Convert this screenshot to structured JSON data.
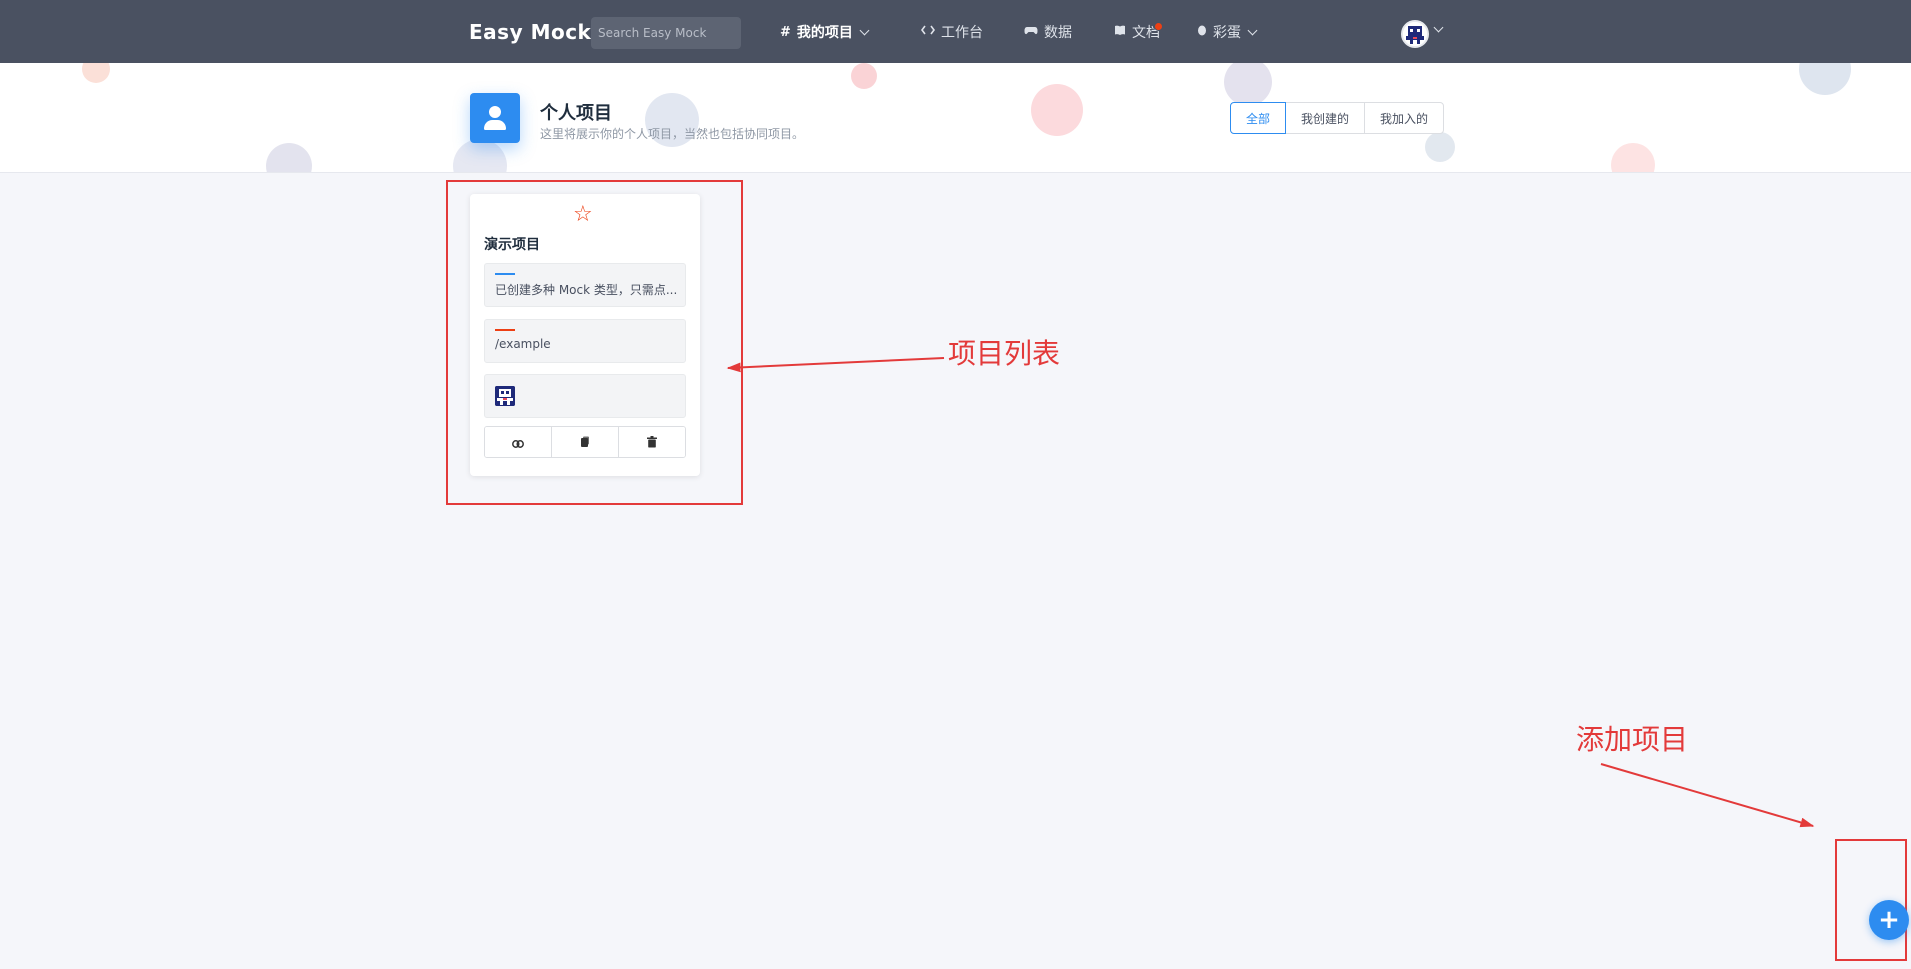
{
  "navbar": {
    "logo": "Easy Mock",
    "search_placeholder": "Search Easy Mock",
    "items": [
      {
        "label": "我的项目",
        "icon": "hash-icon",
        "has_dropdown": true,
        "active": true
      },
      {
        "label": "工作台",
        "icon": "code-icon",
        "has_dropdown": false
      },
      {
        "label": "数据",
        "icon": "gamepad-icon",
        "has_dropdown": false
      },
      {
        "label": "文档",
        "icon": "book-icon",
        "has_dropdown": false,
        "has_badge_dot": true
      },
      {
        "label": "彩蛋",
        "icon": "egg-icon",
        "has_dropdown": true
      }
    ],
    "user_menu": {
      "icon": "user-avatar-icon",
      "has_dropdown": true
    }
  },
  "header": {
    "icon": "person-icon",
    "title": "个人项目",
    "description": "这里将展示你的个人项目，当然也包括协同项目。",
    "filters": [
      {
        "label": "全部",
        "active": true
      },
      {
        "label": "我创建的",
        "active": false
      },
      {
        "label": "我加入的",
        "active": false
      }
    ]
  },
  "projects": [
    {
      "star_icon": "star-outline-icon",
      "name": "演示项目",
      "description": "已创建多种 Mock 类型，只需点...",
      "url": "/example",
      "members": [
        "member-avatar-icon"
      ],
      "actions": [
        "link-icon",
        "copy-icon",
        "trash-icon"
      ]
    }
  ],
  "annotations": {
    "project_list_label": "项目列表",
    "add_project_label": "添加项目"
  },
  "fab": {
    "label": "+",
    "icon": "plus-icon"
  },
  "colors": {
    "navbar_bg": "#4a5161",
    "primary": "#2d8cf0",
    "annotation_red": "#e33a3a",
    "page_bg": "#f5f6fa",
    "description_bar": "#2d8cf0",
    "url_bar": "#ed3f14"
  }
}
